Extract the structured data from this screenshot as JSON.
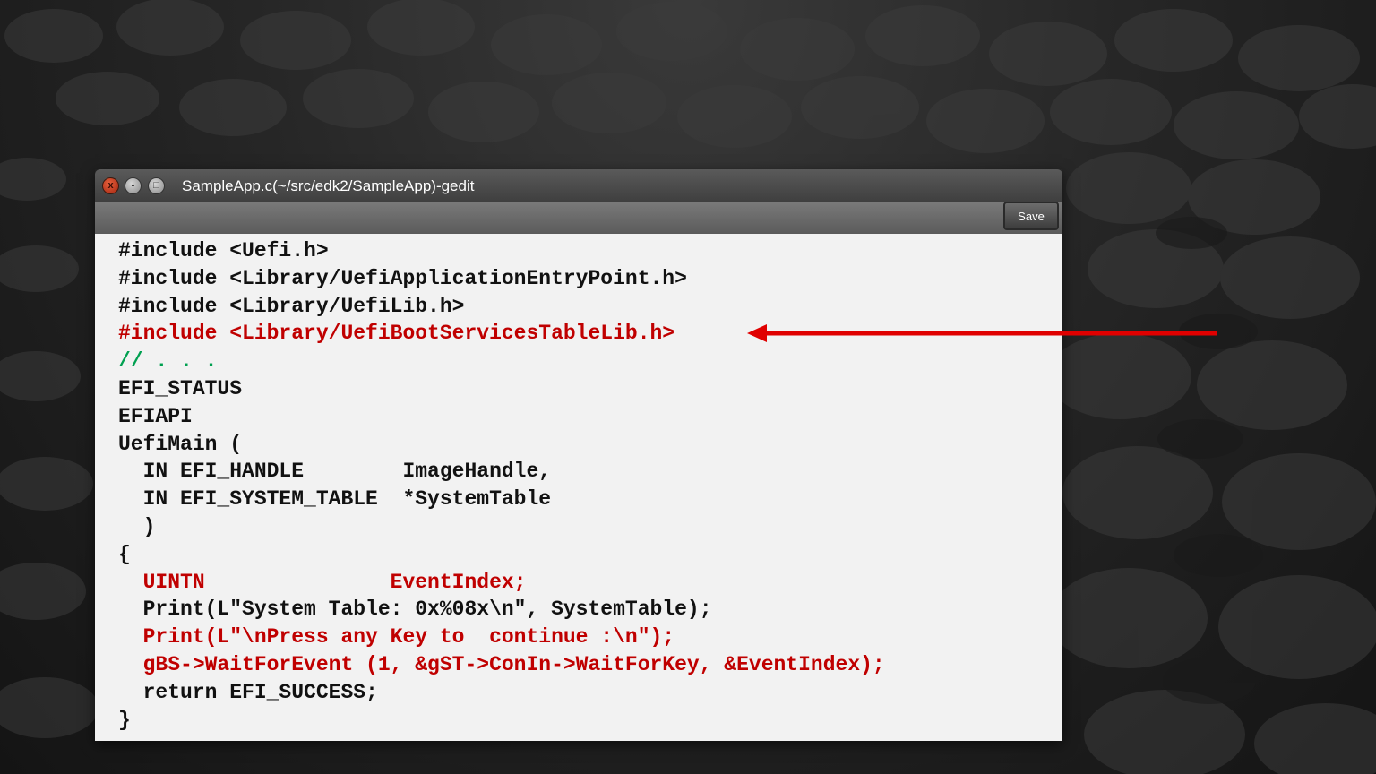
{
  "window": {
    "title": "SampleApp.c(~/src/edk2/SampleApp)-gedit",
    "close_glyph": "x",
    "minimize_glyph": "-",
    "maximize_glyph": "□"
  },
  "toolbar": {
    "save_label": "Save"
  },
  "colors": {
    "code_default": "#111111",
    "code_highlight": "#c00000",
    "code_comment": "#00a050",
    "arrow": "#e00000",
    "editor_bg": "#f2f2f2"
  },
  "code_lines": [
    {
      "text": "#include <Uefi.h>",
      "color": "black"
    },
    {
      "text": "#include <Library/UefiApplicationEntryPoint.h>",
      "color": "black"
    },
    {
      "text": "#include <Library/UefiLib.h>",
      "color": "black"
    },
    {
      "text": "#include <Library/UefiBootServicesTableLib.h>",
      "color": "red"
    },
    {
      "text": "// . . .",
      "color": "green"
    },
    {
      "text": "EFI_STATUS",
      "color": "black"
    },
    {
      "text": "EFIAPI",
      "color": "black"
    },
    {
      "text": "UefiMain (",
      "color": "black"
    },
    {
      "text": "  IN EFI_HANDLE        ImageHandle,",
      "color": "black"
    },
    {
      "text": "  IN EFI_SYSTEM_TABLE  *SystemTable",
      "color": "black"
    },
    {
      "text": "  )",
      "color": "black"
    },
    {
      "text": "{",
      "color": "black"
    },
    {
      "text": "  UINTN               EventIndex;",
      "color": "red"
    },
    {
      "text": "  Print(L\"System Table: 0x%08x\\n\", SystemTable);",
      "color": "black"
    },
    {
      "text": "  Print(L\"\\nPress any Key to  continue :\\n\");",
      "color": "red"
    },
    {
      "text": "  gBS->WaitForEvent (1, &gST->ConIn->WaitForKey, &EventIndex);",
      "color": "red"
    },
    {
      "text": "  return EFI_SUCCESS;",
      "color": "black"
    },
    {
      "text": "}",
      "color": "black"
    }
  ]
}
